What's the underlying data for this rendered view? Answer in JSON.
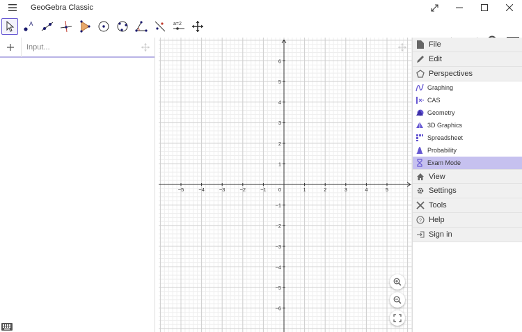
{
  "app": {
    "title": "GeoGebra Classic"
  },
  "algebra": {
    "input_placeholder": "Input..."
  },
  "axes": {
    "x_labels": [
      "−5",
      "−4",
      "−3",
      "−2",
      "−1",
      "0",
      "1",
      "2",
      "3",
      "4",
      "5"
    ],
    "y_labels": [
      "6",
      "5",
      "4",
      "3",
      "2",
      "1",
      "−1",
      "−2",
      "−3",
      "−4",
      "−5",
      "−6"
    ]
  },
  "menu": {
    "file": "File",
    "edit": "Edit",
    "perspectives": "Perspectives",
    "sub": [
      "Graphing",
      "CAS",
      "Geometry",
      "3D Graphics",
      "Spreadsheet",
      "Probability",
      "Exam Mode"
    ],
    "view": "View",
    "settings": "Settings",
    "tools": "Tools",
    "help": "Help",
    "signin": "Sign in"
  },
  "tools": {
    "function_label": "a=2"
  },
  "colors": {
    "accent": "#6557d2",
    "highlight": "#c6c1ef",
    "point": "#1a1a6e"
  }
}
